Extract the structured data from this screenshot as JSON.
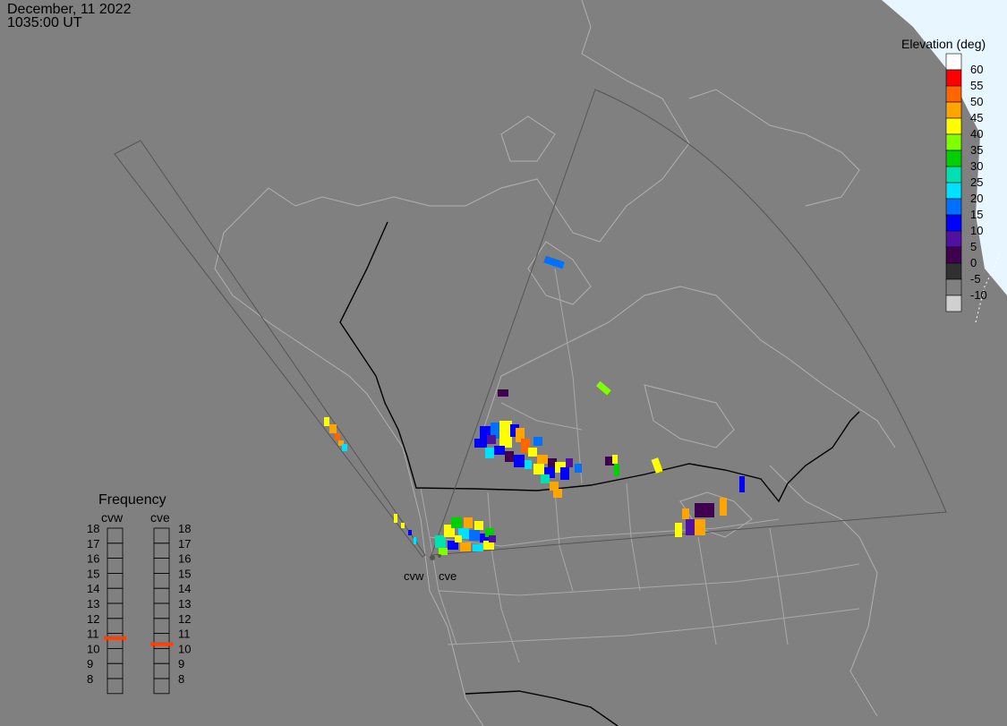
{
  "header": {
    "date": "December, 11 2022",
    "time": "1035:00 UT"
  },
  "legend": {
    "title": "Elevation (deg)",
    "levels": [
      {
        "label": "",
        "color": "#ffffff"
      },
      {
        "label": "60",
        "color": "#ff0000"
      },
      {
        "label": "55",
        "color": "#ff6600"
      },
      {
        "label": "50",
        "color": "#ffa500"
      },
      {
        "label": "45",
        "color": "#ffff00"
      },
      {
        "label": "40",
        "color": "#80ff00"
      },
      {
        "label": "35",
        "color": "#00d000"
      },
      {
        "label": "30",
        "color": "#00e0b0"
      },
      {
        "label": "25",
        "color": "#00e0ff"
      },
      {
        "label": "20",
        "color": "#0070ff"
      },
      {
        "label": "15",
        "color": "#0000ff"
      },
      {
        "label": "10",
        "color": "#5010a0"
      },
      {
        "label": "5",
        "color": "#400050"
      },
      {
        "label": "0",
        "color": "#303030"
      },
      {
        "label": "-5",
        "color": "#808080"
      },
      {
        "label": "-10",
        "color": "#d0d0d0"
      }
    ]
  },
  "frequency": {
    "title": "Frequency",
    "columns": [
      {
        "name": "cvw",
        "selected": 11.2
      },
      {
        "name": "cve",
        "selected": 10.8
      }
    ],
    "ticks": [
      "18",
      "17",
      "16",
      "15",
      "14",
      "13",
      "12",
      "11",
      "10",
      "9",
      "8"
    ],
    "marker_color": "#ff4000"
  },
  "sites": [
    {
      "name": "cvw"
    },
    {
      "name": "cve"
    }
  ],
  "colors": {
    "background": "#808080",
    "coast": "#b0b0b0",
    "border": "#000000",
    "fov": "#555555",
    "daylight": "#e8f6ff"
  }
}
